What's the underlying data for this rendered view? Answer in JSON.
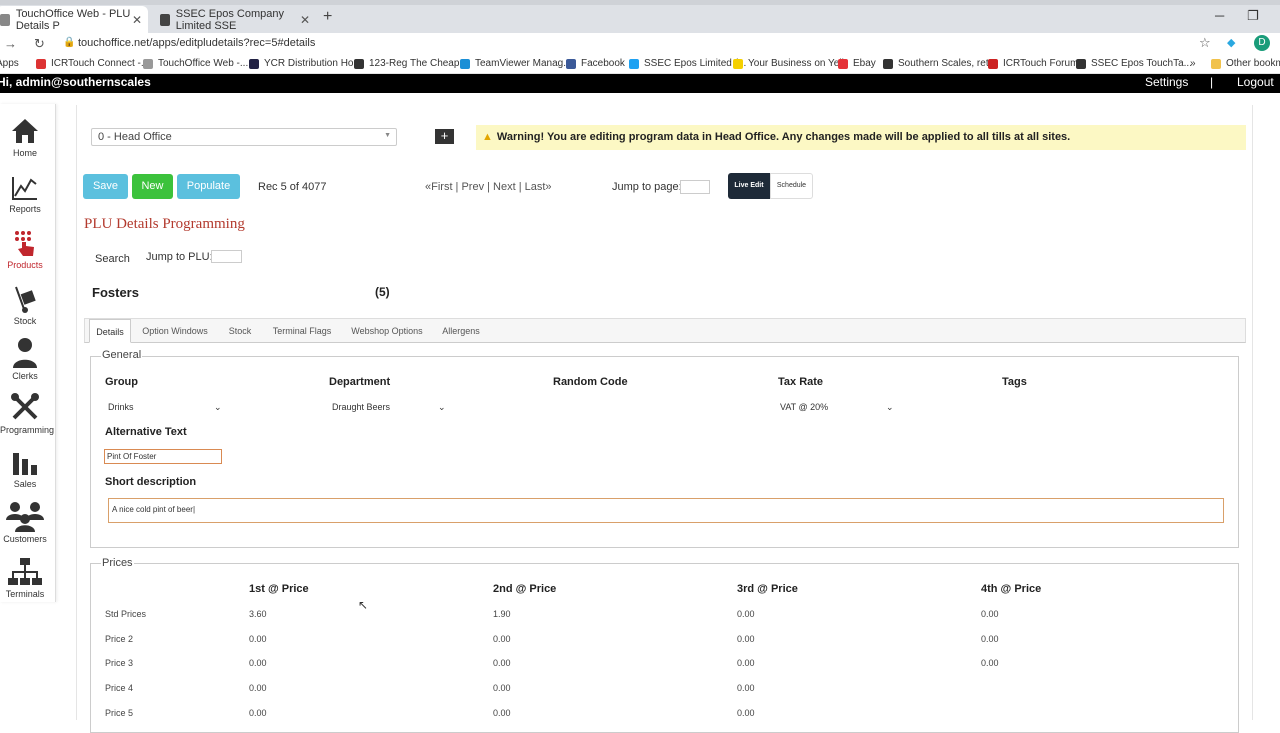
{
  "browser": {
    "tabs": [
      {
        "title": "TouchOffice Web - PLU Details P",
        "active": true
      },
      {
        "title": "SSEC Epos Company Limited SSE",
        "active": false
      }
    ],
    "url": "touchoffice.net/apps/editpludetails?rec=5#details",
    "profile_initial": "D",
    "bookmarks": [
      "Apps",
      "ICRTouch Connect -...",
      "TouchOffice Web -...",
      "YCR Distribution Ho...",
      "123-Reg The Cheap...",
      "TeamViewer Manag...",
      "Facebook",
      "SSEC Epos Limited (...",
      "Your Business on Yell",
      "Ebay",
      "Southern Scales, ret...",
      "ICRTouch Forum",
      "SSEC Epos TouchTa...",
      "Other bookma"
    ],
    "bookmarks_more": "»"
  },
  "header": {
    "user": "Hi, admin@southernscales",
    "settings": "Settings",
    "separator": "|",
    "logout": "Logout"
  },
  "nav": [
    {
      "label": "Home",
      "icon": "home-icon"
    },
    {
      "label": "Reports",
      "icon": "chart-icon"
    },
    {
      "label": "Products",
      "icon": "products-icon",
      "active": true
    },
    {
      "label": "Stock",
      "icon": "trolley-icon"
    },
    {
      "label": "Clerks",
      "icon": "person-icon"
    },
    {
      "label": "Programming",
      "icon": "tools-icon"
    },
    {
      "label": "Sales",
      "icon": "bars-icon"
    },
    {
      "label": "Customers",
      "icon": "people-icon"
    },
    {
      "label": "Terminals",
      "icon": "network-icon"
    }
  ],
  "site": {
    "selected": "0 - Head Office"
  },
  "plus_label": "+",
  "warning": "Warning! You are editing program data in Head Office. Any changes made will be applied to all tills at all sites.",
  "toolbar": {
    "save": "Save",
    "new": "New",
    "populate": "Populate",
    "record_info": "Rec 5 of 4077",
    "pager": "«First | Prev | Next | Last»",
    "jump_label": "Jump to page:",
    "live_edit": "Live Edit",
    "schedule": "Schedule"
  },
  "page_title": "PLU Details Programming",
  "search": {
    "label": "Search",
    "jump_plu": "Jump to PLU:"
  },
  "plu": {
    "name": "Fosters",
    "number": "(5)"
  },
  "tabs": [
    "Details",
    "Option Windows",
    "Stock",
    "Terminal Flags",
    "Webshop Options",
    "Allergens"
  ],
  "general": {
    "legend": "General",
    "group_label": "Group",
    "group_value": "Drinks",
    "department_label": "Department",
    "department_value": "Draught Beers",
    "random_code_label": "Random Code",
    "tax_rate_label": "Tax Rate",
    "tax_rate_value": "VAT @ 20%",
    "tags_label": "Tags",
    "alt_text_label": "Alternative Text",
    "alt_text_value": "Pint Of Foster",
    "short_desc_label": "Short description",
    "short_desc_value": "A nice cold pint of beer|"
  },
  "prices": {
    "legend": "Prices",
    "headers": [
      "1st @ Price",
      "2nd @ Price",
      "3rd @ Price",
      "4th @ Price"
    ],
    "rows": [
      {
        "label": "Std Prices",
        "values": [
          "3.60",
          "1.90",
          "0.00",
          "0.00"
        ]
      },
      {
        "label": "Price 2",
        "values": [
          "0.00",
          "0.00",
          "0.00",
          "0.00"
        ]
      },
      {
        "label": "Price 3",
        "values": [
          "0.00",
          "0.00",
          "0.00",
          "0.00"
        ]
      },
      {
        "label": "Price 4",
        "values": [
          "0.00",
          "0.00",
          "0.00",
          ""
        ]
      },
      {
        "label": "Price 5",
        "values": [
          "0.00",
          "0.00",
          "0.00",
          ""
        ]
      }
    ]
  }
}
